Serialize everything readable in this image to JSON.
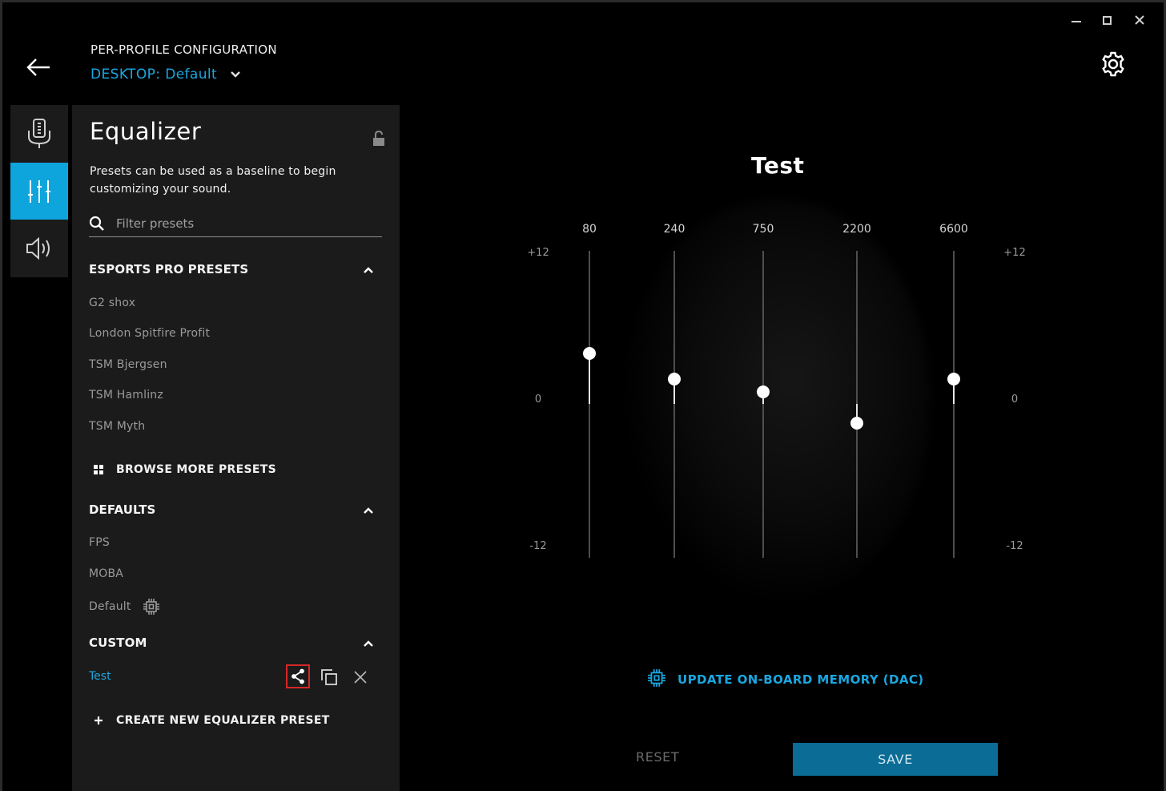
{
  "header": {
    "title": "PER-PROFILE CONFIGURATION",
    "profile_label": "DESKTOP: Default"
  },
  "panel": {
    "title": "Equalizer",
    "description": "Presets can be used as a baseline to begin customizing your sound.",
    "search_placeholder": "Filter presets",
    "esports_section": {
      "title": "ESPORTS PRO PRESETS",
      "items": [
        "G2 shox",
        "London Spitfire Profit",
        "TSM Bjergsen",
        "TSM Hamlinz",
        "TSM Myth"
      ]
    },
    "browse_more_label": "BROWSE MORE PRESETS",
    "defaults_section": {
      "title": "DEFAULTS",
      "items": [
        "FPS",
        "MOBA",
        "Default"
      ]
    },
    "custom_section": {
      "title": "CUSTOM",
      "items": [
        "Test"
      ]
    },
    "create_label": "CREATE NEW EQUALIZER PRESET"
  },
  "equalizer": {
    "preset_name": "Test",
    "db_top": "+12",
    "db_zero": "0",
    "db_bottom": "-12",
    "range_db": [
      -12,
      12
    ],
    "bands": [
      {
        "freq": "80",
        "gain_db": 4.0
      },
      {
        "freq": "240",
        "gain_db": 2.0
      },
      {
        "freq": "750",
        "gain_db": 1.0
      },
      {
        "freq": "2200",
        "gain_db": -1.5
      },
      {
        "freq": "6600",
        "gain_db": 2.0
      }
    ]
  },
  "actions": {
    "update_label": "UPDATE ON-BOARD MEMORY (DAC)",
    "reset_label": "RESET",
    "save_label": "SAVE"
  },
  "colors": {
    "accent": "#1aa7e0",
    "rail_active": "#0ea5dc",
    "save_button": "#0b6c95",
    "share_highlight": "#d62828"
  }
}
